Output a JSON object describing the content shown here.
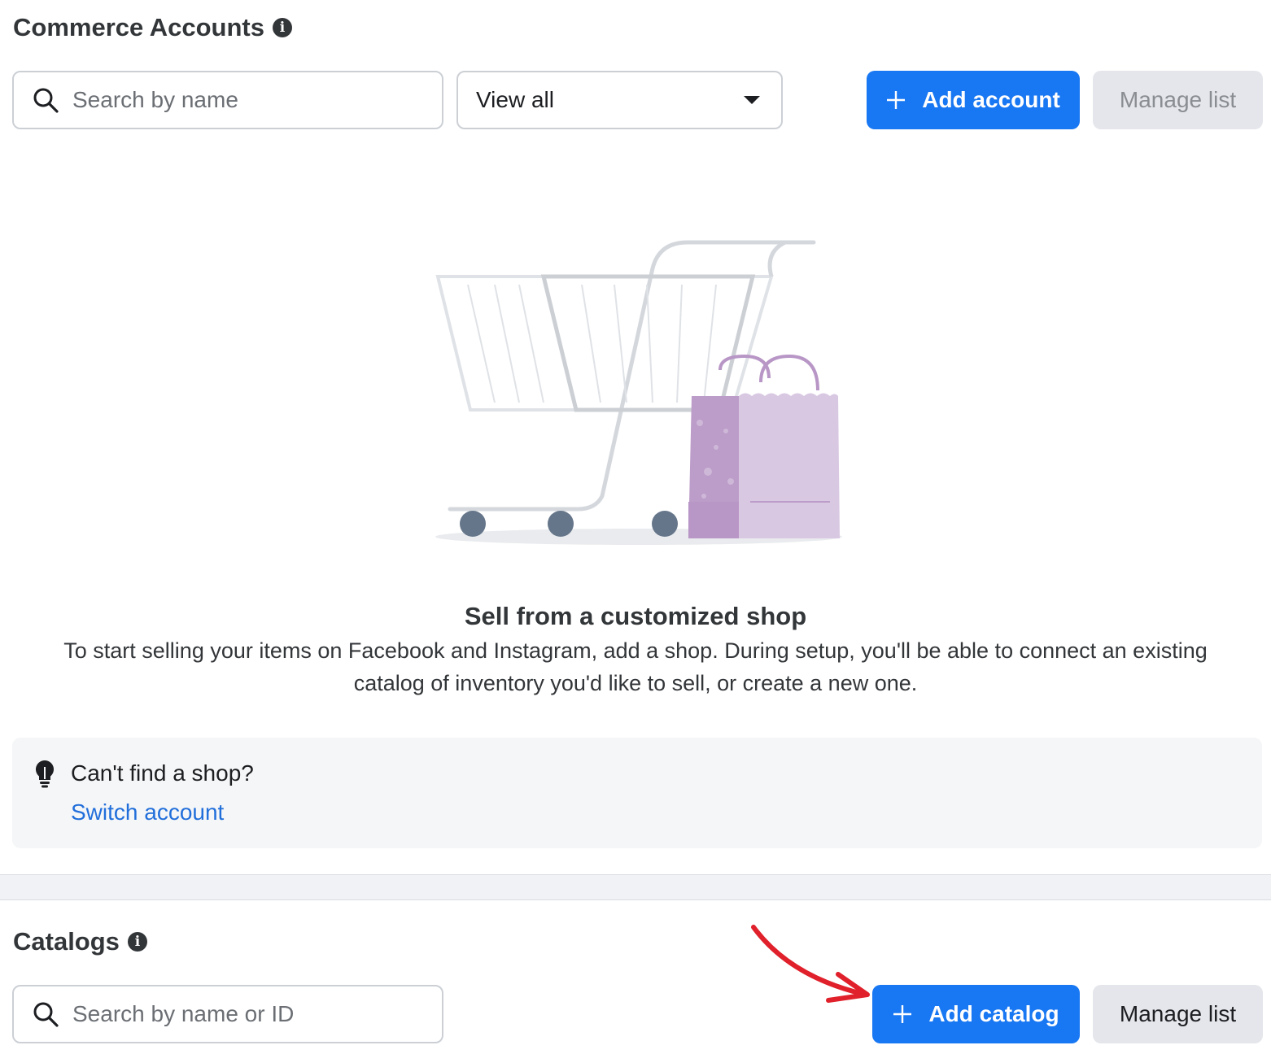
{
  "commerce": {
    "title": "Commerce Accounts",
    "search_placeholder": "Search by name",
    "filter_selected": "View all",
    "add_button": "Add account",
    "manage_button": "Manage list"
  },
  "empty_state": {
    "title": "Sell from a customized shop",
    "description": "To start selling your items on Facebook and Instagram, add a shop. During setup, you'll be able to connect an existing catalog of inventory you'd like to sell, or create a new one.",
    "illustration": "shopping-cart-with-bags"
  },
  "tip": {
    "icon": "lightbulb-icon",
    "title": "Can't find a shop?",
    "link": "Switch account"
  },
  "catalogs": {
    "title": "Catalogs",
    "search_placeholder": "Search by name or ID",
    "add_button": "Add catalog",
    "manage_button": "Manage list"
  },
  "colors": {
    "primary": "#1877f2",
    "link": "#216fdb",
    "annotation_arrow": "#e0202a"
  }
}
